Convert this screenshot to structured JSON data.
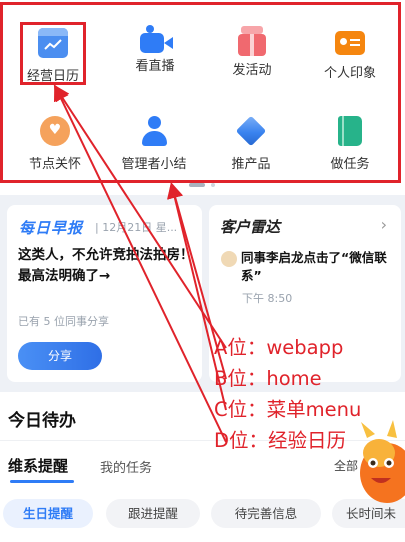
{
  "menu": {
    "items": [
      {
        "label": "经营日历",
        "icon": "calendar-chart-icon"
      },
      {
        "label": "看直播",
        "icon": "video-camera-icon"
      },
      {
        "label": "发活动",
        "icon": "gift-icon"
      },
      {
        "label": "个人印象",
        "icon": "id-card-icon"
      },
      {
        "label": "节点关怀",
        "icon": "heart-chat-icon"
      },
      {
        "label": "管理者小结",
        "icon": "person-icon"
      },
      {
        "label": "推产品",
        "icon": "cube-icon"
      },
      {
        "label": "做任务",
        "icon": "book-icon"
      }
    ]
  },
  "daily": {
    "logo": "每日早报",
    "meta": "| 12月21日 星...",
    "text": "这类人，不允许竞拍法拍房！最高法明确了→",
    "count": "已有 5 位同事分享",
    "share_label": "分享"
  },
  "customer": {
    "title": "客户雷达",
    "arrow": "›",
    "text": "同事李启龙点击了“微信联系”",
    "time": "下午 8:50"
  },
  "todo": {
    "title": "今日待办",
    "tab_active": "维系提醒",
    "tab_other": "我的任务",
    "tab_all": "全部",
    "chips": [
      "生日提醒",
      "跟进提醒",
      "待完善信息",
      "长时间未"
    ]
  },
  "annotations": {
    "a": "A位：webapp",
    "b": "B位：home",
    "c": "C位：菜单menu",
    "d": "D位：经验日历"
  },
  "colors": {
    "accent": "#2f7cf6",
    "annotation": "#e0232b"
  }
}
